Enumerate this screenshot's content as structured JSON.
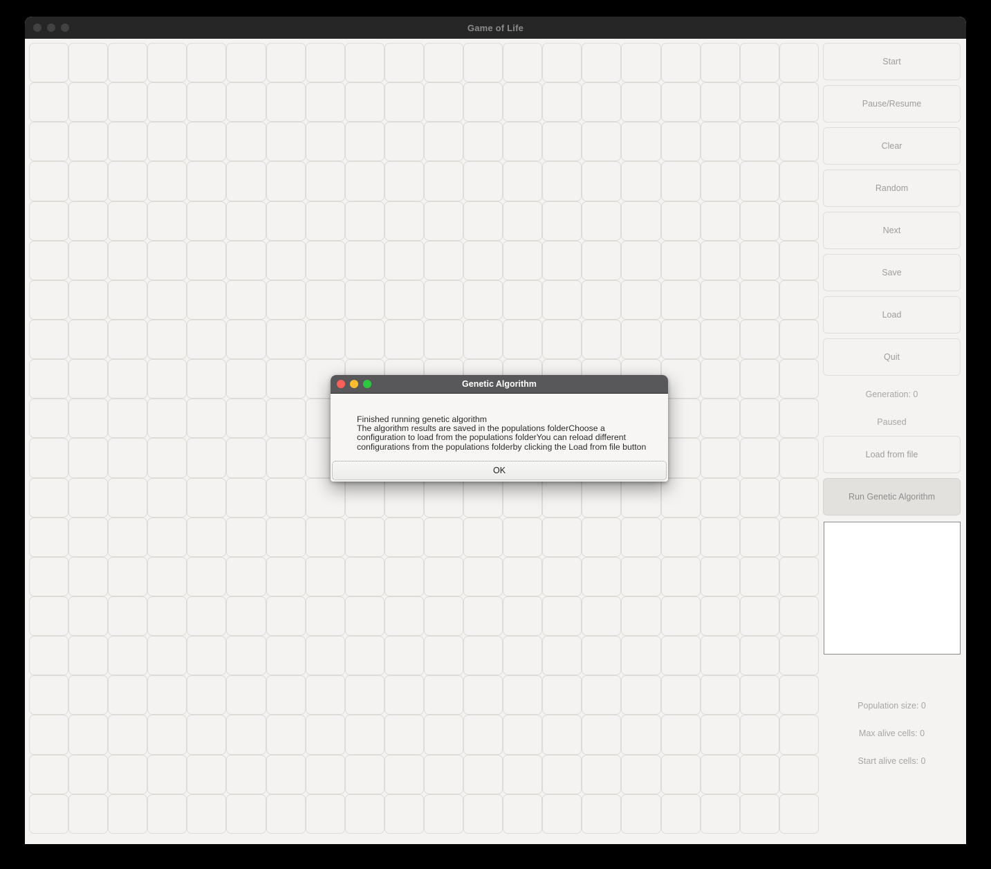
{
  "window": {
    "title": "Game of Life",
    "traffic_lights": [
      "close-inactive",
      "minimize-inactive",
      "maximize-inactive"
    ]
  },
  "grid": {
    "columns": 20,
    "rows": 20,
    "alive_cells": []
  },
  "sidebar": {
    "buttons": [
      {
        "label": "Start",
        "name": "start-button",
        "state": "normal"
      },
      {
        "label": "Pause/Resume",
        "name": "pause-resume-button",
        "state": "normal"
      },
      {
        "label": "Clear",
        "name": "clear-button",
        "state": "normal"
      },
      {
        "label": "Random",
        "name": "random-button",
        "state": "normal"
      },
      {
        "label": "Next",
        "name": "next-button",
        "state": "normal"
      },
      {
        "label": "Save",
        "name": "save-button",
        "state": "normal"
      },
      {
        "label": "Load",
        "name": "load-button",
        "state": "normal"
      },
      {
        "label": "Quit",
        "name": "quit-button",
        "state": "normal"
      }
    ],
    "generation_label": "Generation: 0",
    "status_label": "Paused",
    "load_from_file_label": "Load from file",
    "run_genetic_algorithm_label": "Run Genetic Algorithm",
    "output_text": "",
    "stats": [
      {
        "label": "Population size: 0"
      },
      {
        "label": "Max alive cells: 0"
      },
      {
        "label": "Start alive cells: 0"
      }
    ]
  },
  "dialog": {
    "title": "Genetic Algorithm",
    "message": "Finished running genetic algorithm\nThe algorithm results are saved in the populations folderChoose a configuration to load from the populations folderYou can reload different configurations from the populations folderby clicking the Load from file button",
    "ok_label": "OK",
    "traffic_lights": [
      "close",
      "minimize",
      "maximize"
    ]
  },
  "colors": {
    "window_titlebar": "#262626",
    "dialog_titlebar": "#58585a",
    "app_background": "#f4f3f1",
    "cell_border": "#dedbd7",
    "pressed_button": "#e2e1de",
    "close": "#fc5f57",
    "minimize": "#febc2e",
    "maximize": "#2cc840"
  }
}
